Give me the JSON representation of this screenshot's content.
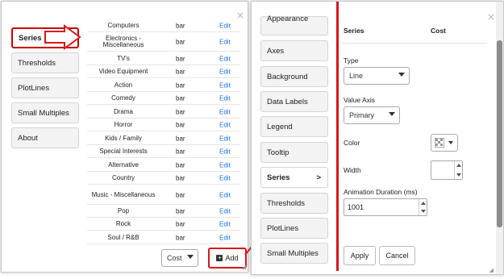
{
  "left_panel": {
    "nav": [
      {
        "label": "Series",
        "active": true
      },
      {
        "label": "Thresholds"
      },
      {
        "label": "PlotLines"
      },
      {
        "label": "Small Multiples"
      },
      {
        "label": "About"
      }
    ],
    "rows": [
      {
        "name": "Computers",
        "type": "bar",
        "action": "Edit"
      },
      {
        "name": "Electronics - Miscellaneous",
        "type": "bar",
        "action": "Edit"
      },
      {
        "name": "TV's",
        "type": "bar",
        "action": "Edit"
      },
      {
        "name": "Video Equipment",
        "type": "bar",
        "action": "Edit"
      },
      {
        "name": "Action",
        "type": "bar",
        "action": "Edit"
      },
      {
        "name": "Comedy",
        "type": "bar",
        "action": "Edit"
      },
      {
        "name": "Drama",
        "type": "bar",
        "action": "Edit"
      },
      {
        "name": "Horror",
        "type": "bar",
        "action": "Edit"
      },
      {
        "name": "Kids / Family",
        "type": "bar",
        "action": "Edit"
      },
      {
        "name": "Special Interests",
        "type": "bar",
        "action": "Edit"
      },
      {
        "name": "Alternative",
        "type": "bar",
        "action": "Edit"
      },
      {
        "name": "Country",
        "type": "bar",
        "action": "Edit"
      },
      {
        "name": "Music - Miscellaneous",
        "type": "bar",
        "action": "Edit"
      },
      {
        "name": "Pop",
        "type": "bar",
        "action": "Edit"
      },
      {
        "name": "Rock",
        "type": "bar",
        "action": "Edit"
      },
      {
        "name": "Soul / R&B",
        "type": "bar",
        "action": "Edit"
      }
    ],
    "measure_select": "Cost",
    "add_label": "Add",
    "close": "×"
  },
  "right_panel": {
    "nav": [
      {
        "label": "Appearance"
      },
      {
        "label": "Axes"
      },
      {
        "label": "Background"
      },
      {
        "label": "Data Labels"
      },
      {
        "label": "Legend"
      },
      {
        "label": "Tooltip"
      },
      {
        "label": "Series",
        "active": true,
        "chevron": ">"
      },
      {
        "label": "Thresholds"
      },
      {
        "label": "PlotLines"
      },
      {
        "label": "Small Multiples"
      }
    ],
    "header": {
      "col1": "Series",
      "col2": "Cost"
    },
    "type_label": "Type",
    "type_value": "Line",
    "axis_label": "Value Axis",
    "axis_value": "Primary",
    "color_label": "Color",
    "width_label": "Width",
    "width_value": "",
    "duration_label": "Animation Duration (ms)",
    "duration_value": "1001",
    "apply_label": "Apply",
    "cancel_label": "Cancel",
    "close": "×"
  },
  "colors": {
    "highlight": "#d9161b",
    "link": "#1a73e8"
  }
}
